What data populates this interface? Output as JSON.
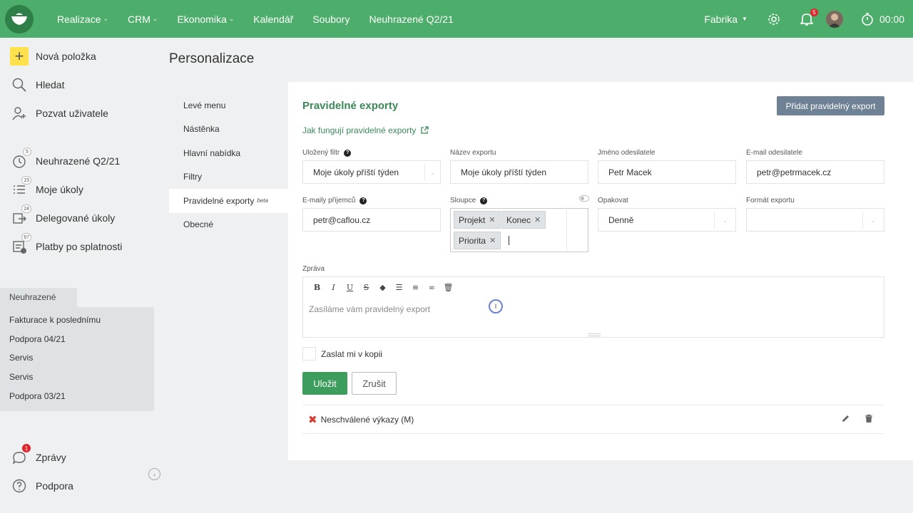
{
  "topbar": {
    "nav": [
      {
        "label": "Realizace",
        "dropdown": true
      },
      {
        "label": "CRM",
        "dropdown": true
      },
      {
        "label": "Ekonomika",
        "dropdown": true
      },
      {
        "label": "Kalendář",
        "dropdown": false
      },
      {
        "label": "Soubory",
        "dropdown": false
      },
      {
        "label": "Neuhrazené Q2/21",
        "dropdown": false
      }
    ],
    "company": "Fabrika",
    "notifications_count": "5",
    "timer": "00:00"
  },
  "sidebar": {
    "top_items": [
      {
        "label": "Nová položka",
        "icon": "plus-icon"
      },
      {
        "label": "Hledat",
        "icon": "search-icon"
      },
      {
        "label": "Pozvat uživatele",
        "icon": "invite-user-icon"
      }
    ],
    "list_items": [
      {
        "label": "Neuhrazené Q2/21",
        "icon": "clock-icon",
        "count": "5"
      },
      {
        "label": "Moje úkoly",
        "icon": "tasks-icon",
        "count": "15"
      },
      {
        "label": "Delegované úkoly",
        "icon": "delegate-icon",
        "count": "24"
      },
      {
        "label": "Platby po splatnosti",
        "icon": "payments-icon",
        "count": "67"
      }
    ],
    "favorites_title": "Neuhrazené",
    "favorites": [
      "Fakturace k poslednímu",
      "Podpora 04/21",
      "Servis",
      "Servis",
      "Podpora 03/21"
    ],
    "bottom_items": [
      {
        "label": "Zprávy",
        "icon": "chat-icon",
        "count": "1"
      },
      {
        "label": "Podpora",
        "icon": "help-icon"
      }
    ]
  },
  "page": {
    "title": "Personalizace",
    "subnav": [
      "Levé menu",
      "Nástěnka",
      "Hlavní nabídka",
      "Filtry",
      "Pravidelné exporty",
      "Obecné"
    ],
    "subnav_active_beta": "beta"
  },
  "panel": {
    "title": "Pravidelné exporty",
    "add_button": "Přidat pravidelný export",
    "help_link": "Jak fungují pravidelné exporty",
    "fields": {
      "saved_filter": {
        "label": "Uložený filtr",
        "value": "Moje úkoly příští týden"
      },
      "export_name": {
        "label": "Název exportu",
        "value": "Moje úkoly příští týden"
      },
      "sender_name": {
        "label": "Jméno odesilatele",
        "value": "Petr Macek"
      },
      "sender_email": {
        "label": "E-mail odesilatele",
        "value": "petr@petrmacek.cz"
      },
      "recipients": {
        "label": "E-maily příjemců",
        "value": "petr@caflou.cz"
      },
      "columns": {
        "label": "Sloupce",
        "tags": [
          "Projekt",
          "Konec",
          "Priorita"
        ]
      },
      "repeat": {
        "label": "Opakovat",
        "value": "Denně"
      },
      "format": {
        "label": "Formát exportu",
        "value": ""
      }
    },
    "message": {
      "label": "Zpráva",
      "text": "Zasíláme vám pravidelný export"
    },
    "copy_checkbox": "Zaslat mi v kopii",
    "save": "Uložit",
    "cancel": "Zrušit",
    "exports": [
      {
        "name": "Neschválené výkazy (M)"
      }
    ]
  },
  "colors": {
    "brand": "#4cae6a",
    "accent_text": "#3a8a57",
    "add_button": "#6e8195"
  }
}
